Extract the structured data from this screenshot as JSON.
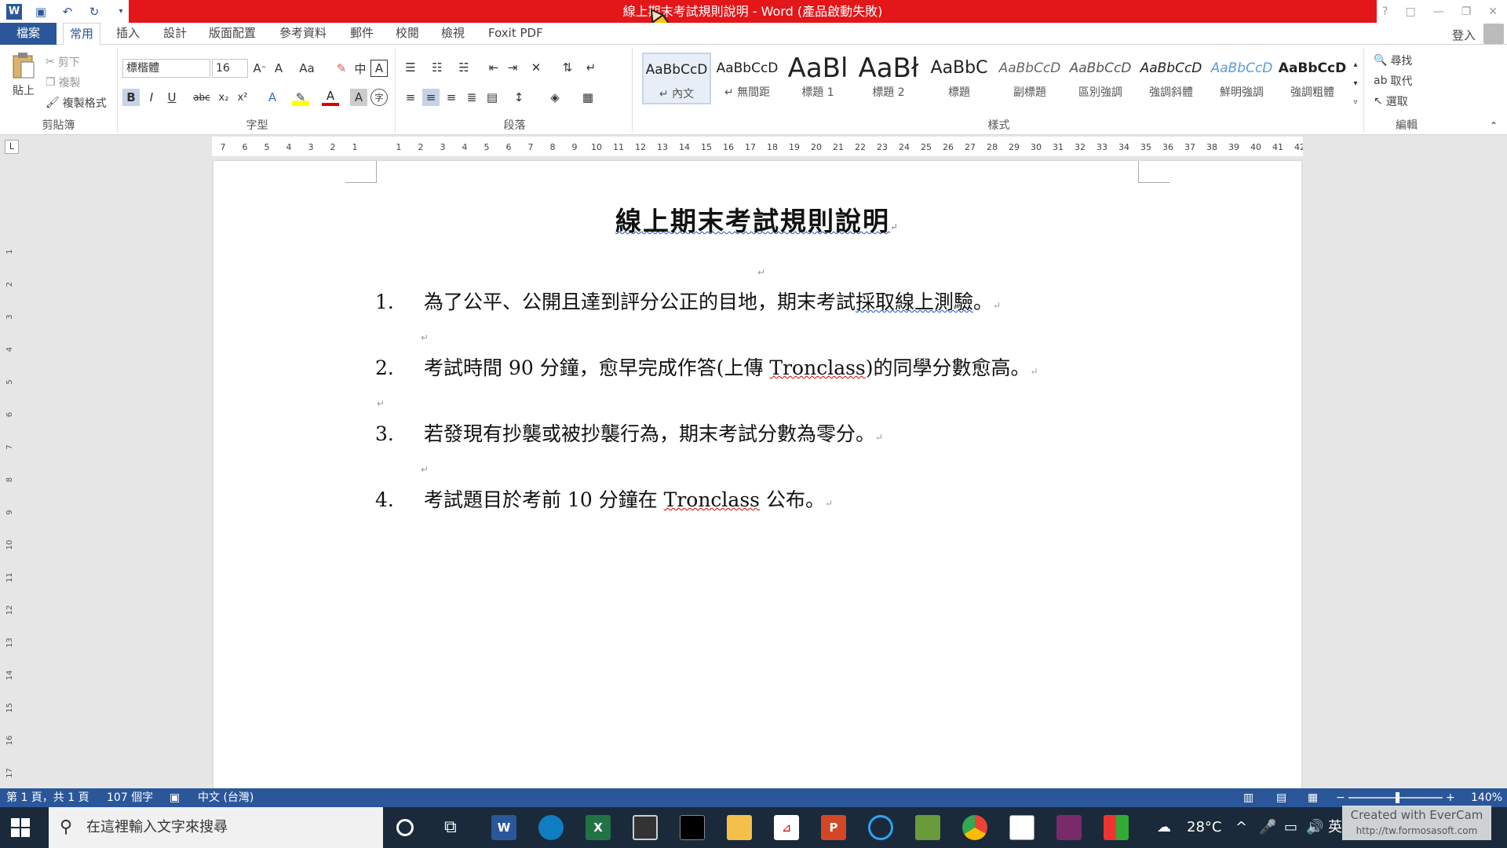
{
  "titlebar": {
    "title": "線上期末考試規則說明 - Word (產品啟動失敗)",
    "help": "?",
    "controls": [
      "□",
      "—",
      "❐",
      "✕"
    ]
  },
  "tabs": [
    "檔案",
    "常用",
    "插入",
    "設計",
    "版面配置",
    "參考資料",
    "郵件",
    "校閱",
    "檢視",
    "Foxit PDF"
  ],
  "signin": "登入",
  "clipboard": {
    "paste": "貼上",
    "cut": "剪下",
    "copy": "複製",
    "format_painter": "複製格式",
    "label": "剪貼簿"
  },
  "font": {
    "name": "標楷體",
    "size": "16",
    "label": "字型",
    "aa": "Aa",
    "bold": "B",
    "italic": "I",
    "underline": "U",
    "strike": "abc"
  },
  "paragraph": {
    "label": "段落"
  },
  "styles": {
    "label": "樣式",
    "items": [
      {
        "preview": "AaBbCcD",
        "name": "↵ 內文"
      },
      {
        "preview": "AaBbCcD",
        "name": "↵ 無間距"
      },
      {
        "preview": "AaBl",
        "name": "標題 1"
      },
      {
        "preview": "AaBł",
        "name": "標題 2"
      },
      {
        "preview": "AaBbC",
        "name": "標題"
      },
      {
        "preview": "AaBbCcD",
        "name": "副標題"
      },
      {
        "preview": "AaBbCcD",
        "name": "區別強調"
      },
      {
        "preview": "AaBbCcD",
        "name": "強調斜體"
      },
      {
        "preview": "AaBbCcD",
        "name": "鮮明強調"
      },
      {
        "preview": "AaBbCcD",
        "name": "強調粗體"
      }
    ]
  },
  "editing": {
    "find": "尋找",
    "replace": "取代",
    "select": "選取",
    "label": "編輯"
  },
  "document": {
    "title": "線上期末考試規則說明",
    "items": [
      {
        "num": "1.",
        "pre": "為了公平、公開且達到評分公正的目地，期末考試",
        "mid": "採取線上測驗",
        "post": "。"
      },
      {
        "num": "2.",
        "pre": "考試時間 90 分鐘，愈早完成作答(上傳 ",
        "mid": "Tronclass",
        "post": ")的同學分數愈高。"
      },
      {
        "num": "3.",
        "pre": "若發現有抄襲或被抄襲行為，期末考試分數為零分。",
        "mid": "",
        "post": ""
      },
      {
        "num": "4.",
        "pre": "考試題目於考前 10 分鐘在 ",
        "mid": "Tronclass",
        "post": " 公布。"
      }
    ]
  },
  "status": {
    "page": "第 1 頁，共 1 頁",
    "words": "107 個字",
    "language": "中文 (台灣)",
    "zoom": "140%"
  },
  "taskbar": {
    "search_placeholder": "在這裡輸入文字來搜尋",
    "temp": "28°C",
    "ime": "英"
  },
  "watermark": {
    "line1": "Created with EverCam",
    "line2": "http://tw.formosasoft.com"
  }
}
